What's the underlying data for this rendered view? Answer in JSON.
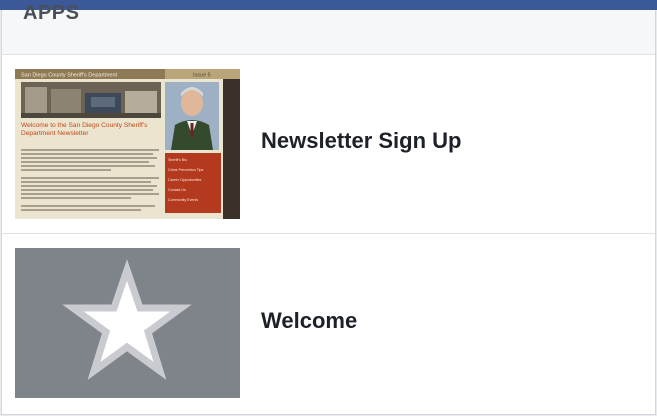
{
  "header": {
    "section_title": "APPS"
  },
  "apps": [
    {
      "label": "Newsletter Sign Up",
      "thumbnail": {
        "banner": "San Diego County Sheriff's Department",
        "issue": "Issue 5",
        "headline": "Welcome to the San Diego County Sheriff's Department Newsletter",
        "side_links": [
          "Sheriff's Bio",
          "Crime Prevention Tips",
          "Career Opportunities",
          "Contact Us",
          "Community Events"
        ]
      }
    },
    {
      "label": "Welcome",
      "thumbnail": {
        "icon": "star-icon"
      }
    }
  ],
  "colors": {
    "brand_bar": "#3b5998",
    "panel_bg": "#ffffff",
    "header_bg": "#f6f7f9",
    "star_bg": "#7f838a"
  }
}
